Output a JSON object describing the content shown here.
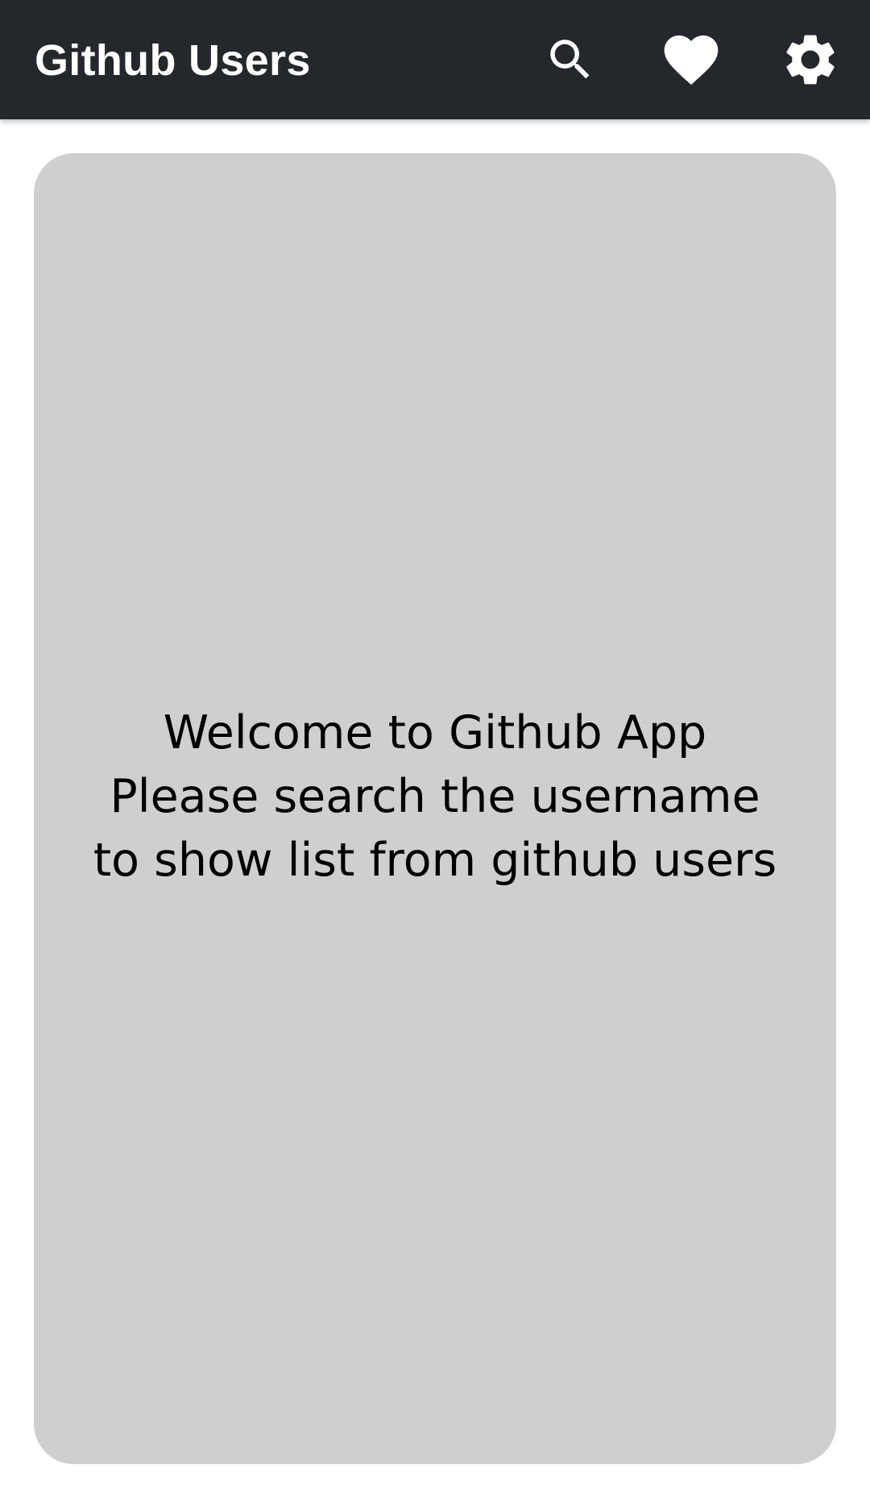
{
  "app_bar": {
    "title": "Github Users",
    "background": "#24282d",
    "actions": [
      {
        "name": "search",
        "icon": "search-icon"
      },
      {
        "name": "favorite",
        "icon": "heart-icon"
      },
      {
        "name": "settings",
        "icon": "gear-icon"
      }
    ]
  },
  "main": {
    "card_background": "#cfcfcf",
    "empty_message": {
      "line1": "Welcome to Github App",
      "line2": "Please search the username",
      "line3": "to show list from github users"
    }
  }
}
